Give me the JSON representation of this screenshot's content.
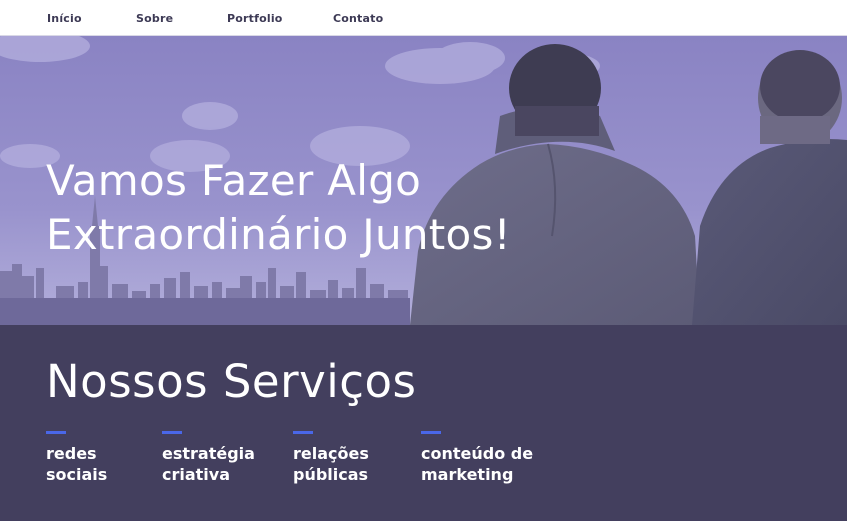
{
  "nav": {
    "items": [
      {
        "label": "Início"
      },
      {
        "label": "Sobre"
      },
      {
        "label": "Portfolio"
      },
      {
        "label": "Contato"
      }
    ]
  },
  "hero": {
    "title_line1": "Vamos Fazer Algo",
    "title_line2": "Extraordinário Juntos!"
  },
  "services": {
    "title": "Nossos Serviços",
    "items": [
      {
        "label": "redes\nsociais"
      },
      {
        "label": "estratégia\ncriativa"
      },
      {
        "label": "relações\npúblicas"
      },
      {
        "label": "conteúdo de\nmarketing"
      }
    ]
  },
  "colors": {
    "accent": "#4a67e8",
    "services_bg": "#433f5e",
    "hero_tint": "#8d86c6"
  }
}
